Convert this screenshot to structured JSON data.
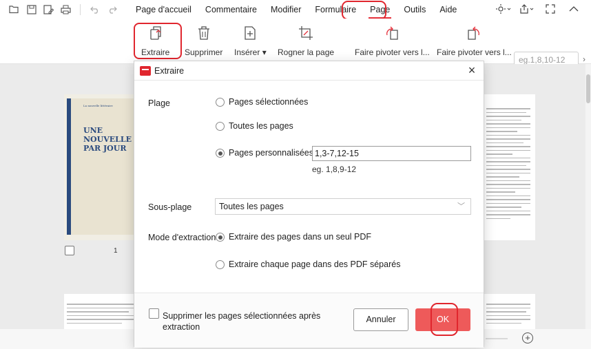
{
  "menubar": {
    "items": [
      "Page d'accueil",
      "Commentaire",
      "Modifier",
      "Formulaire",
      "Page",
      "Outils",
      "Aide"
    ],
    "active": "Page"
  },
  "toolbar": {
    "extract_label": "Extraire",
    "delete_label": "Supprimer",
    "insert_label": "Insérer",
    "crop_label": "Rogner la page",
    "rotate_left_label": "Faire pivoter vers l...",
    "rotate_right_label": "Faire pivoter vers l...",
    "page_range_placeholder": "eg.1,8,10-12"
  },
  "thumbnails": {
    "cover_small": "La nouvelle littéraire",
    "cover_title_line1": "UNE NOUVELLE",
    "cover_title_line2": "PAR JOUR",
    "page_number": "1"
  },
  "dialog": {
    "title": "Extraire",
    "range_label": "Plage",
    "range_options": [
      "Pages sélectionnées",
      "Toutes les pages",
      "Pages personnalisées"
    ],
    "range_selected": "Pages personnalisées",
    "custom_value": "1,3-7,12-15",
    "custom_hint": "eg. 1,8,9-12",
    "subrange_label": "Sous-plage",
    "subrange_value": "Toutes les pages",
    "mode_label": "Mode d'extraction",
    "mode_options": [
      "Extraire des pages dans un seul PDF",
      "Extraire chaque page dans des PDF séparés"
    ],
    "mode_selected": "Extraire des pages dans un seul PDF",
    "delete_after_label": "Supprimer les pages sélectionnées après extraction",
    "cancel_label": "Annuler",
    "ok_label": "OK"
  },
  "colors": {
    "accent": "#e5303a",
    "highlight": "#e0262e",
    "ok_button": "#ee5a5a"
  }
}
